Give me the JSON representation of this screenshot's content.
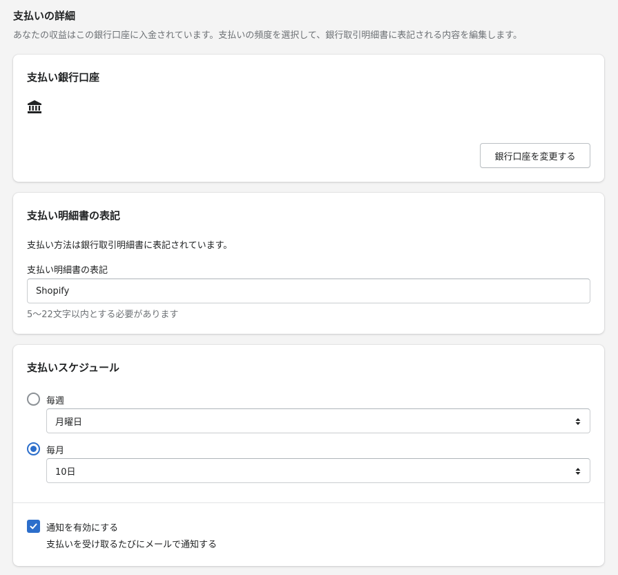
{
  "header": {
    "title": "支払いの詳細",
    "description": "あなたの収益はこの銀行口座に入金されています。支払いの頻度を選択して、銀行取引明細書に表記される内容を編集します。"
  },
  "bank_card": {
    "title": "支払い銀行口座",
    "icon": "bank-icon",
    "change_button_label": "銀行口座を変更する"
  },
  "statement_card": {
    "title": "支払い明細書の表記",
    "description": "支払い方法は銀行取引明細書に表記されています。",
    "field_label": "支払い明細書の表記",
    "field_value": "Shopify",
    "help_text": "5〜22文字以内とする必要があります"
  },
  "schedule_card": {
    "title": "支払いスケジュール",
    "weekly_label": "毎週",
    "weekly_checked": false,
    "weekly_select_value": "月曜日",
    "monthly_label": "毎月",
    "monthly_checked": true,
    "monthly_select_value": "10日",
    "notify_label": "通知を有効にする",
    "notify_checked": true,
    "notify_help": "支払いを受け取るたびにメールで通知する"
  },
  "colors": {
    "accent": "#2c6ecb",
    "background": "#f4f4f4",
    "subdued_text": "#6d7175"
  }
}
